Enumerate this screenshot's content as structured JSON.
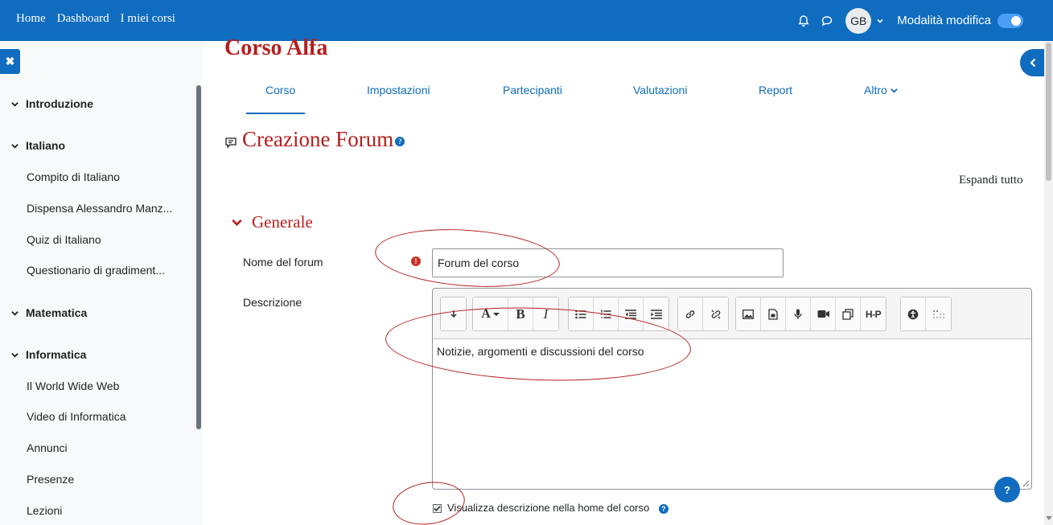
{
  "navbar": {
    "links": [
      "Home",
      "Dashboard",
      "I miei corsi"
    ],
    "avatar_initials": "GB",
    "edit_mode_label": "Modalità modifica",
    "edit_mode_on": true
  },
  "drawer": {
    "sections": [
      {
        "title": "Introduzione",
        "items": []
      },
      {
        "title": "Italiano",
        "items": [
          "Compito di Italiano",
          "Dispensa Alessandro Manz...",
          "Quiz di Italiano",
          "Questionario di gradiment..."
        ]
      },
      {
        "title": "Matematica",
        "items": []
      },
      {
        "title": "Informatica",
        "items": [
          "Il World Wide Web",
          "Video di Informatica",
          "Annunci",
          "Presenze",
          "Lezioni"
        ]
      }
    ]
  },
  "course": {
    "title": "Corso Alfa",
    "tabs": [
      "Corso",
      "Impostazioni",
      "Partecipanti",
      "Valutazioni",
      "Report",
      "Altro"
    ],
    "active_tab": "Corso"
  },
  "page": {
    "title": "Creazione Forum",
    "expand_all": "Espandi tutto",
    "section_title": "Generale"
  },
  "form": {
    "forum_name_label": "Nome del forum",
    "forum_name_value": "Forum del corso",
    "description_label": "Descrizione",
    "description_value": "Notizie, argomenti e discussioni del corso",
    "show_description_label": "Visualizza descrizione nella home del corso",
    "show_description_checked": true
  },
  "editor_toolbar": {
    "font_button": "A",
    "bold_button": "B",
    "italic_button": "I",
    "h5p_button": "H-P"
  },
  "colors": {
    "brand": "#0f6cbf",
    "heading": "#b51e1e",
    "required": "#ca3120"
  }
}
